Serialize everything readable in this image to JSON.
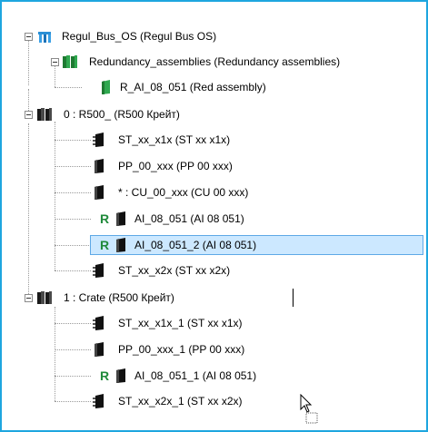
{
  "tree": {
    "root": {
      "label": "Regul_Bus_OS (Regul Bus OS)",
      "icon": "bus-icon"
    },
    "redundancy": {
      "label": "Redundancy_assemblies (Redundancy assemblies)",
      "icon": "green-assemblies-icon"
    },
    "red_assembly": {
      "label": "R_AI_08_051 (Red assembly)",
      "icon": "green-module-icon"
    },
    "crate0": {
      "label": "0 : R500_ (R500 Крейт)",
      "icon": "crate-icon"
    },
    "crate0_children": [
      {
        "label": "ST_xx_x1x (ST xx x1x)",
        "icon": "terminal-module-icon",
        "redundant": false
      },
      {
        "label": "PP_00_xxx (PP 00 xxx)",
        "icon": "module-icon",
        "redundant": false
      },
      {
        "label": "* : CU_00_xxx (CU 00 xxx)",
        "icon": "module-icon",
        "redundant": false
      },
      {
        "label": "AI_08_051 (AI 08 051)",
        "icon": "module-icon",
        "redundant": true
      },
      {
        "label": "AI_08_051_2 (AI 08 051)",
        "icon": "module-icon",
        "redundant": true,
        "selected": true
      },
      {
        "label": "ST_xx_x2x (ST xx x2x)",
        "icon": "terminal-module-icon",
        "redundant": false
      }
    ],
    "crate1": {
      "label": "1 : Crate (R500 Крейт)",
      "icon": "crate-icon"
    },
    "crate1_children": [
      {
        "label": "ST_xx_x1x_1 (ST xx x1x)",
        "icon": "terminal-module-icon",
        "redundant": false
      },
      {
        "label": "PP_00_xxx_1 (PP 00 xxx)",
        "icon": "module-icon",
        "redundant": false
      },
      {
        "label": "AI_08_051_1 (AI 08 051)",
        "icon": "module-icon",
        "redundant": true
      },
      {
        "label": "ST_xx_x2x_1 (ST xx x2x)",
        "icon": "terminal-module-icon",
        "redundant": false
      }
    ],
    "redundant_badge": "R"
  },
  "colors": {
    "frame_border": "#1ea6df",
    "selection_bg": "#cce8ff",
    "selection_border": "#5ea8e6",
    "redundant_badge": "#1f8a3a",
    "assembly_green": "#2fa84f"
  }
}
